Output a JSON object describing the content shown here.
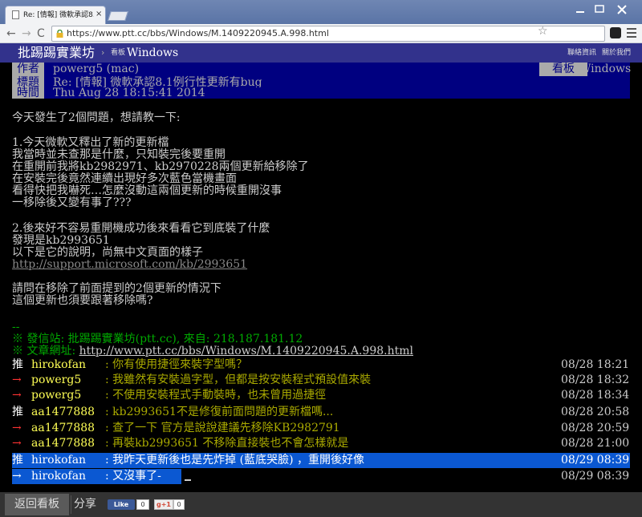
{
  "browser": {
    "tab_title": "Re: [情報] 微軟承認8.1例",
    "tab_close": "×",
    "url": "https://www.ptt.cc/bbs/Windows/M.1409220945.A.998.html",
    "back_icon": "←",
    "forward_icon": "→",
    "reload_icon": "C",
    "star_icon": "☆"
  },
  "topbar": {
    "home": "批踢踢實業坊",
    "arrow": "›",
    "board_tag": "看板",
    "board": "Windows",
    "contact": "聯絡資訊",
    "about": "關於我們"
  },
  "meta": {
    "author_label": "作者",
    "author": "powerg5 (mac)",
    "board_label": "看板",
    "board": "Windows",
    "title_label": "標題",
    "title": "Re: [情報] 微軟承認8.1例行性更新有bug",
    "time_label": "時間",
    "time": "Thu Aug 28 18:15:41 2014"
  },
  "article": {
    "lines": [
      "今天發生了2個問題，想請教一下:",
      "1.今天微軟又釋出了新的更新檔",
      "我當時並未查那是什麼，只知裝完後要重開",
      "在重開前我將kb2982971、kb2970228兩個更新給移除了",
      "在安裝完後竟然連續出現好多次藍色當機畫面",
      "看得快把我嚇死…怎麼沒動這兩個更新的時候重開沒事",
      "一移除後又變有事了???",
      "2.後來好不容易重開機成功後來看看它到底裝了什麼",
      "發現是kb2993651",
      "以下是它的說明，尚無中文頁面的樣子",
      "http://support.microsoft.com/kb/2993651",
      "請問在移除了前面提到的2個更新的情況下",
      "這個更新也須要跟著移除嗎?"
    ],
    "signature_sep": "--",
    "origin": "※ 發信站: 批踢踢實業坊(ptt.cc), 來自: 218.187.181.12",
    "url_prefix": "※ 文章網址: ",
    "url": "http://www.ptt.cc/bbs/Windows/M.1409220945.A.998.html"
  },
  "pushes": [
    {
      "tag": "推",
      "user": "hirokofan",
      "comment": ": 你有使用捷徑來裝字型嗎？",
      "time": "08/28 18:21"
    },
    {
      "tag": "→",
      "user": "powerg5",
      "comment": ": 我雖然有安裝過字型，但都是按安裝程式預設值來裝",
      "time": "08/28 18:32"
    },
    {
      "tag": "→",
      "user": "powerg5",
      "comment": ": 不使用安裝程式手動裝時，也未曾用過捷徑",
      "time": "08/28 18:34"
    },
    {
      "tag": "推",
      "user": "aa1477888",
      "comment": ": kb2993651不是修復前面問題的更新檔嗎...",
      "time": "08/28 20:58"
    },
    {
      "tag": "→",
      "user": "aa1477888",
      "comment": ": 查了一下 官方是說說建議先移除KB2982791",
      "time": "08/28 20:59"
    },
    {
      "tag": "→",
      "user": "aa1477888",
      "comment": ": 再裝kb2993651 不移除直接裝也不會怎樣就是",
      "time": "08/28 21:00"
    },
    {
      "tag": "推",
      "user": "hirokofan",
      "comment": ": 我昨天更新後也是先炸掉 (藍底哭臉) ，重開後好像",
      "time": "08/29 08:39"
    },
    {
      "tag": "→",
      "user": "hirokofan",
      "comment": ": 又沒事了-",
      "time": "08/29 08:39"
    }
  ],
  "bottombar": {
    "back": "返回看板",
    "share": "分享",
    "fb_like": "Like",
    "fb_count": "0",
    "gplus": "g+1",
    "gplus_count": "0"
  }
}
